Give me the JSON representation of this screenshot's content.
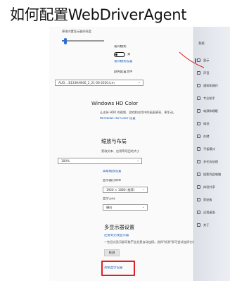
{
  "heading": "如何配置WebDriverAgent",
  "main": {
    "top_label": "更改内置显示器的亮度",
    "night_light_label": "夜间模式",
    "night_light_state": "关",
    "night_light_settings_link": "夜间模式设置",
    "color_profile_label": "颜色配置文件",
    "color_profile_value": "AUO... B133HAN06_2_21-06-2020.icm",
    "hdr_title": "Windows HD Color",
    "hdr_desc": "让支持 HDR 的视频、游戏和应用中的画面更亮、更生动。",
    "hdr_link": "Windows HD Color 设置",
    "scale_title": "缩放与布局",
    "scale_label": "更改文本、应用等项目的大小",
    "scale_value": "100%",
    "scale_advanced_link": "高级缩放设置",
    "resolution_label": "显示器分辨率",
    "resolution_value": "1920 × 1080 (推荐)",
    "orientation_label": "显示方向",
    "orientation_value": "横向",
    "multi_title": "多显示器设置",
    "multi_link_connect": "连接到无线显示器",
    "multi_desc": "一些旧式显示器可能不会总是自动连接。选择\"检测\"即可尝试连接它们。",
    "detect_button": "检测",
    "advanced_display_link": "高级显示设置"
  },
  "sidebar": {
    "home": "系统",
    "items": [
      {
        "label": "显示",
        "icon": "monitor-icon",
        "active": true
      },
      {
        "label": "声音",
        "icon": "speaker-icon"
      },
      {
        "label": "通知和操作",
        "icon": "notification-icon"
      },
      {
        "label": "专注助手",
        "icon": "moon-icon"
      },
      {
        "label": "电源和睡眠",
        "icon": "power-icon"
      },
      {
        "label": "电池",
        "icon": "battery-icon"
      },
      {
        "label": "存储",
        "icon": "storage-icon"
      },
      {
        "label": "平板模式",
        "icon": "tablet-icon"
      },
      {
        "label": "多任务处理",
        "icon": "multitask-icon"
      },
      {
        "label": "投影到此电脑",
        "icon": "project-icon"
      },
      {
        "label": "体验共享",
        "icon": "share-icon"
      },
      {
        "label": "剪贴板",
        "icon": "clipboard-icon"
      },
      {
        "label": "远程桌面",
        "icon": "remote-icon"
      },
      {
        "label": "关于",
        "icon": "info-icon"
      }
    ]
  },
  "colors": {
    "accent": "#2a6ed6",
    "link": "#1a5fb4",
    "highlight": "#e02020"
  },
  "brightness": 0.05
}
